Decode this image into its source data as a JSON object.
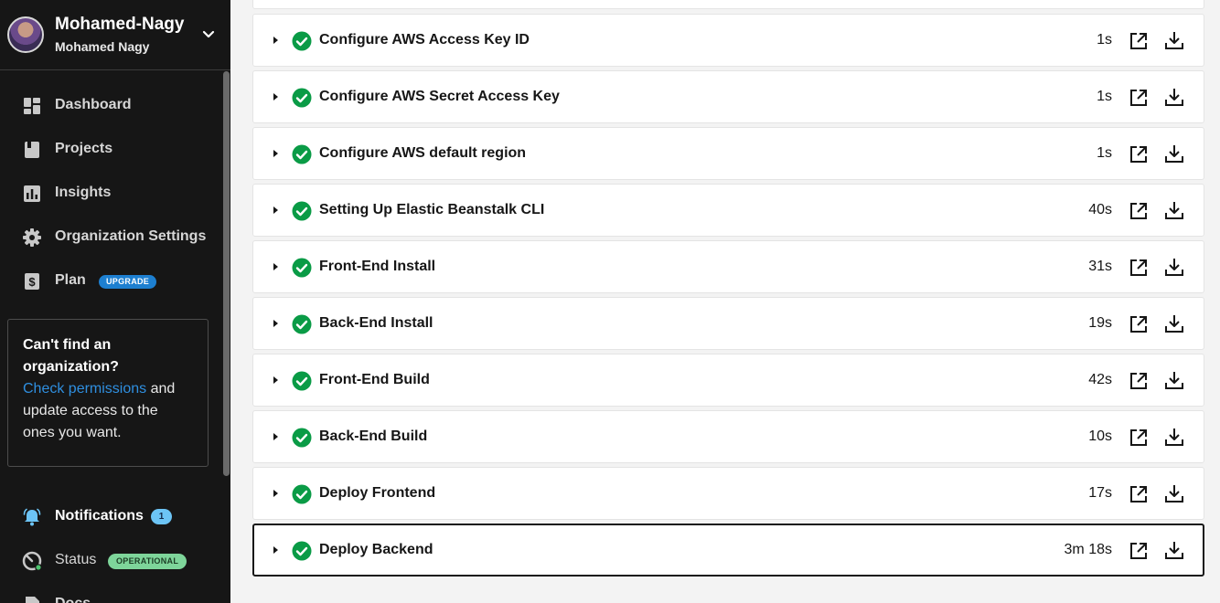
{
  "org": {
    "name": "Mohamed-Nagy",
    "user": "Mohamed Nagy"
  },
  "nav": {
    "dashboard": "Dashboard",
    "projects": "Projects",
    "insights": "Insights",
    "org_settings": "Organization Settings",
    "plan": "Plan",
    "upgrade": "UPGRADE",
    "notifications": "Notifications",
    "notifications_count": "1",
    "status": "Status",
    "status_badge": "OPERATIONAL",
    "docs": "Docs"
  },
  "help_card": {
    "title": "Can't find an organization?",
    "link": "Check permissions",
    "text": " and update access to the ones you want."
  },
  "colors": {
    "success": "#0a9b46",
    "link": "#2f8fe0",
    "sidebar_bg": "#161616"
  },
  "steps": [
    {
      "name": "Configure AWS Access Key ID",
      "duration": "1s"
    },
    {
      "name": "Configure AWS Secret Access Key",
      "duration": "1s"
    },
    {
      "name": "Configure AWS default region",
      "duration": "1s"
    },
    {
      "name": "Setting Up Elastic Beanstalk CLI",
      "duration": "40s"
    },
    {
      "name": "Front-End Install",
      "duration": "31s"
    },
    {
      "name": "Back-End Install",
      "duration": "19s"
    },
    {
      "name": "Front-End Build",
      "duration": "42s"
    },
    {
      "name": "Back-End Build",
      "duration": "10s"
    },
    {
      "name": "Deploy Frontend",
      "duration": "17s"
    },
    {
      "name": "Deploy Backend",
      "duration": "3m 18s"
    }
  ]
}
